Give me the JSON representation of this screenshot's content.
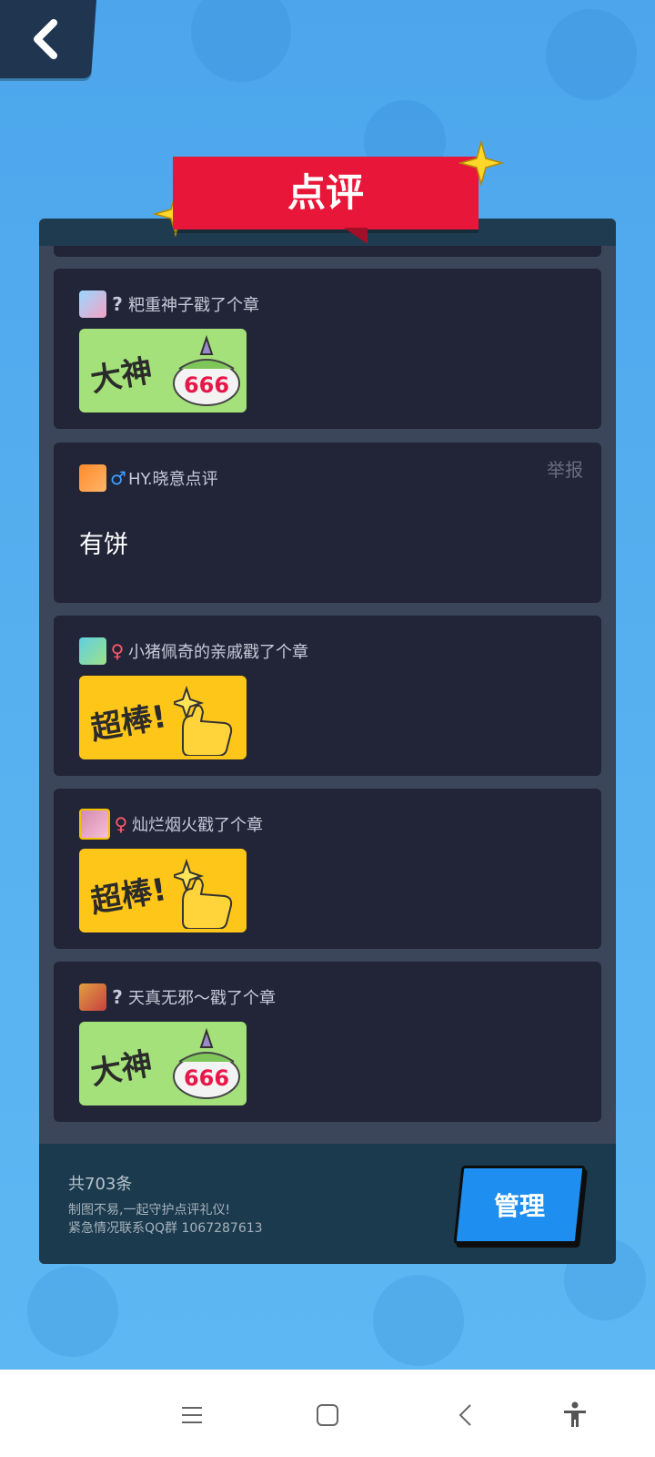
{
  "header": {
    "title": "点评"
  },
  "reviews": [
    {
      "sex": "?",
      "name": "粑重神子戳了个章",
      "stamp": "大神",
      "stamp_badge": "666",
      "stamp_type": "green"
    },
    {
      "sex": "♂",
      "name": "HY.晓意点评",
      "report": "举报",
      "comment": "有饼"
    },
    {
      "sex": "♀",
      "name": "小猪佩奇的亲戚戳了个章",
      "stamp": "超棒!",
      "stamp_type": "yellow"
    },
    {
      "sex": "♀",
      "name": "灿烂烟火戳了个章",
      "stamp": "超棒!",
      "stamp_type": "yellow"
    },
    {
      "sex": "?",
      "name": "天真无邪～戳了个章",
      "stamp": "大神",
      "stamp_badge": "666",
      "stamp_type": "green"
    }
  ],
  "footer": {
    "count": "共703条",
    "note1": "制图不易,一起守护点评礼仪!",
    "note2": "紧急情况联系QQ群 1067287613",
    "manage_label": "管理"
  },
  "colors": {
    "ribbon": "#e8173a",
    "panel": "#222437",
    "manage": "#1e8ff0",
    "male": "#3fa0ff",
    "female": "#ff5a6a",
    "unknown": "#c8c9d8"
  },
  "icons": {
    "back": "chevron-left-icon",
    "menu": "menu-icon",
    "home": "home-square-icon",
    "back_nav": "back-arrow-icon",
    "accessibility": "accessibility-icon"
  }
}
